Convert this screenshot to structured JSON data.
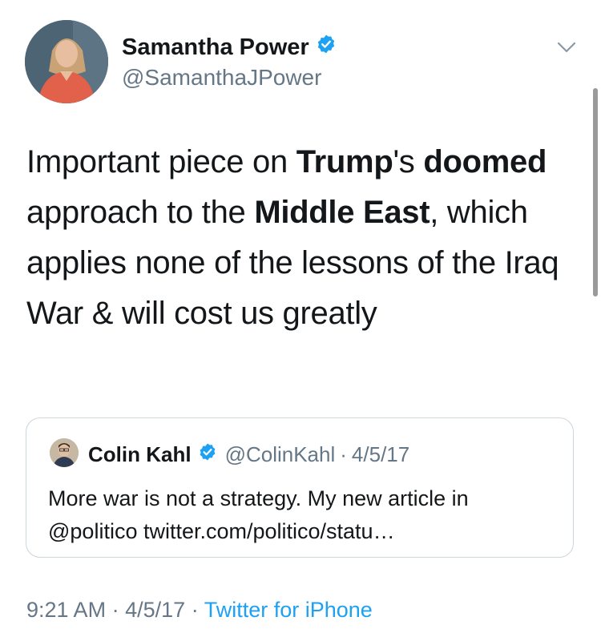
{
  "author": {
    "name": "Samantha Power",
    "handle": "@SamanthaJPower"
  },
  "tweet": {
    "segments": [
      {
        "text": "Important piece on ",
        "bold": false
      },
      {
        "text": "Trump",
        "bold": true
      },
      {
        "text": "'s ",
        "bold": false
      },
      {
        "text": "doomed",
        "bold": true
      },
      {
        "text": " approach to the ",
        "bold": false
      },
      {
        "text": "Middle East",
        "bold": true
      },
      {
        "text": ", which applies none of the lessons of the Iraq War & will cost us greatly",
        "bold": false
      }
    ]
  },
  "quoted": {
    "name": "Colin Kahl",
    "handle": "@ColinKahl",
    "separator": "·",
    "date": "4/5/17",
    "text": "More war is not a strategy. My new article in @politico twitter.com/politico/statu…"
  },
  "footer": {
    "time": "9:21 AM",
    "separator1": "·",
    "date": "4/5/17",
    "separator2": "·",
    "source": "Twitter for iPhone"
  },
  "colors": {
    "verified": "#1da1f2",
    "link": "#1da1f2",
    "secondary_text": "#657786",
    "border": "#ccd6dd"
  },
  "icons": {
    "verified": "verified-badge-icon",
    "menu": "chevron-down-icon"
  }
}
